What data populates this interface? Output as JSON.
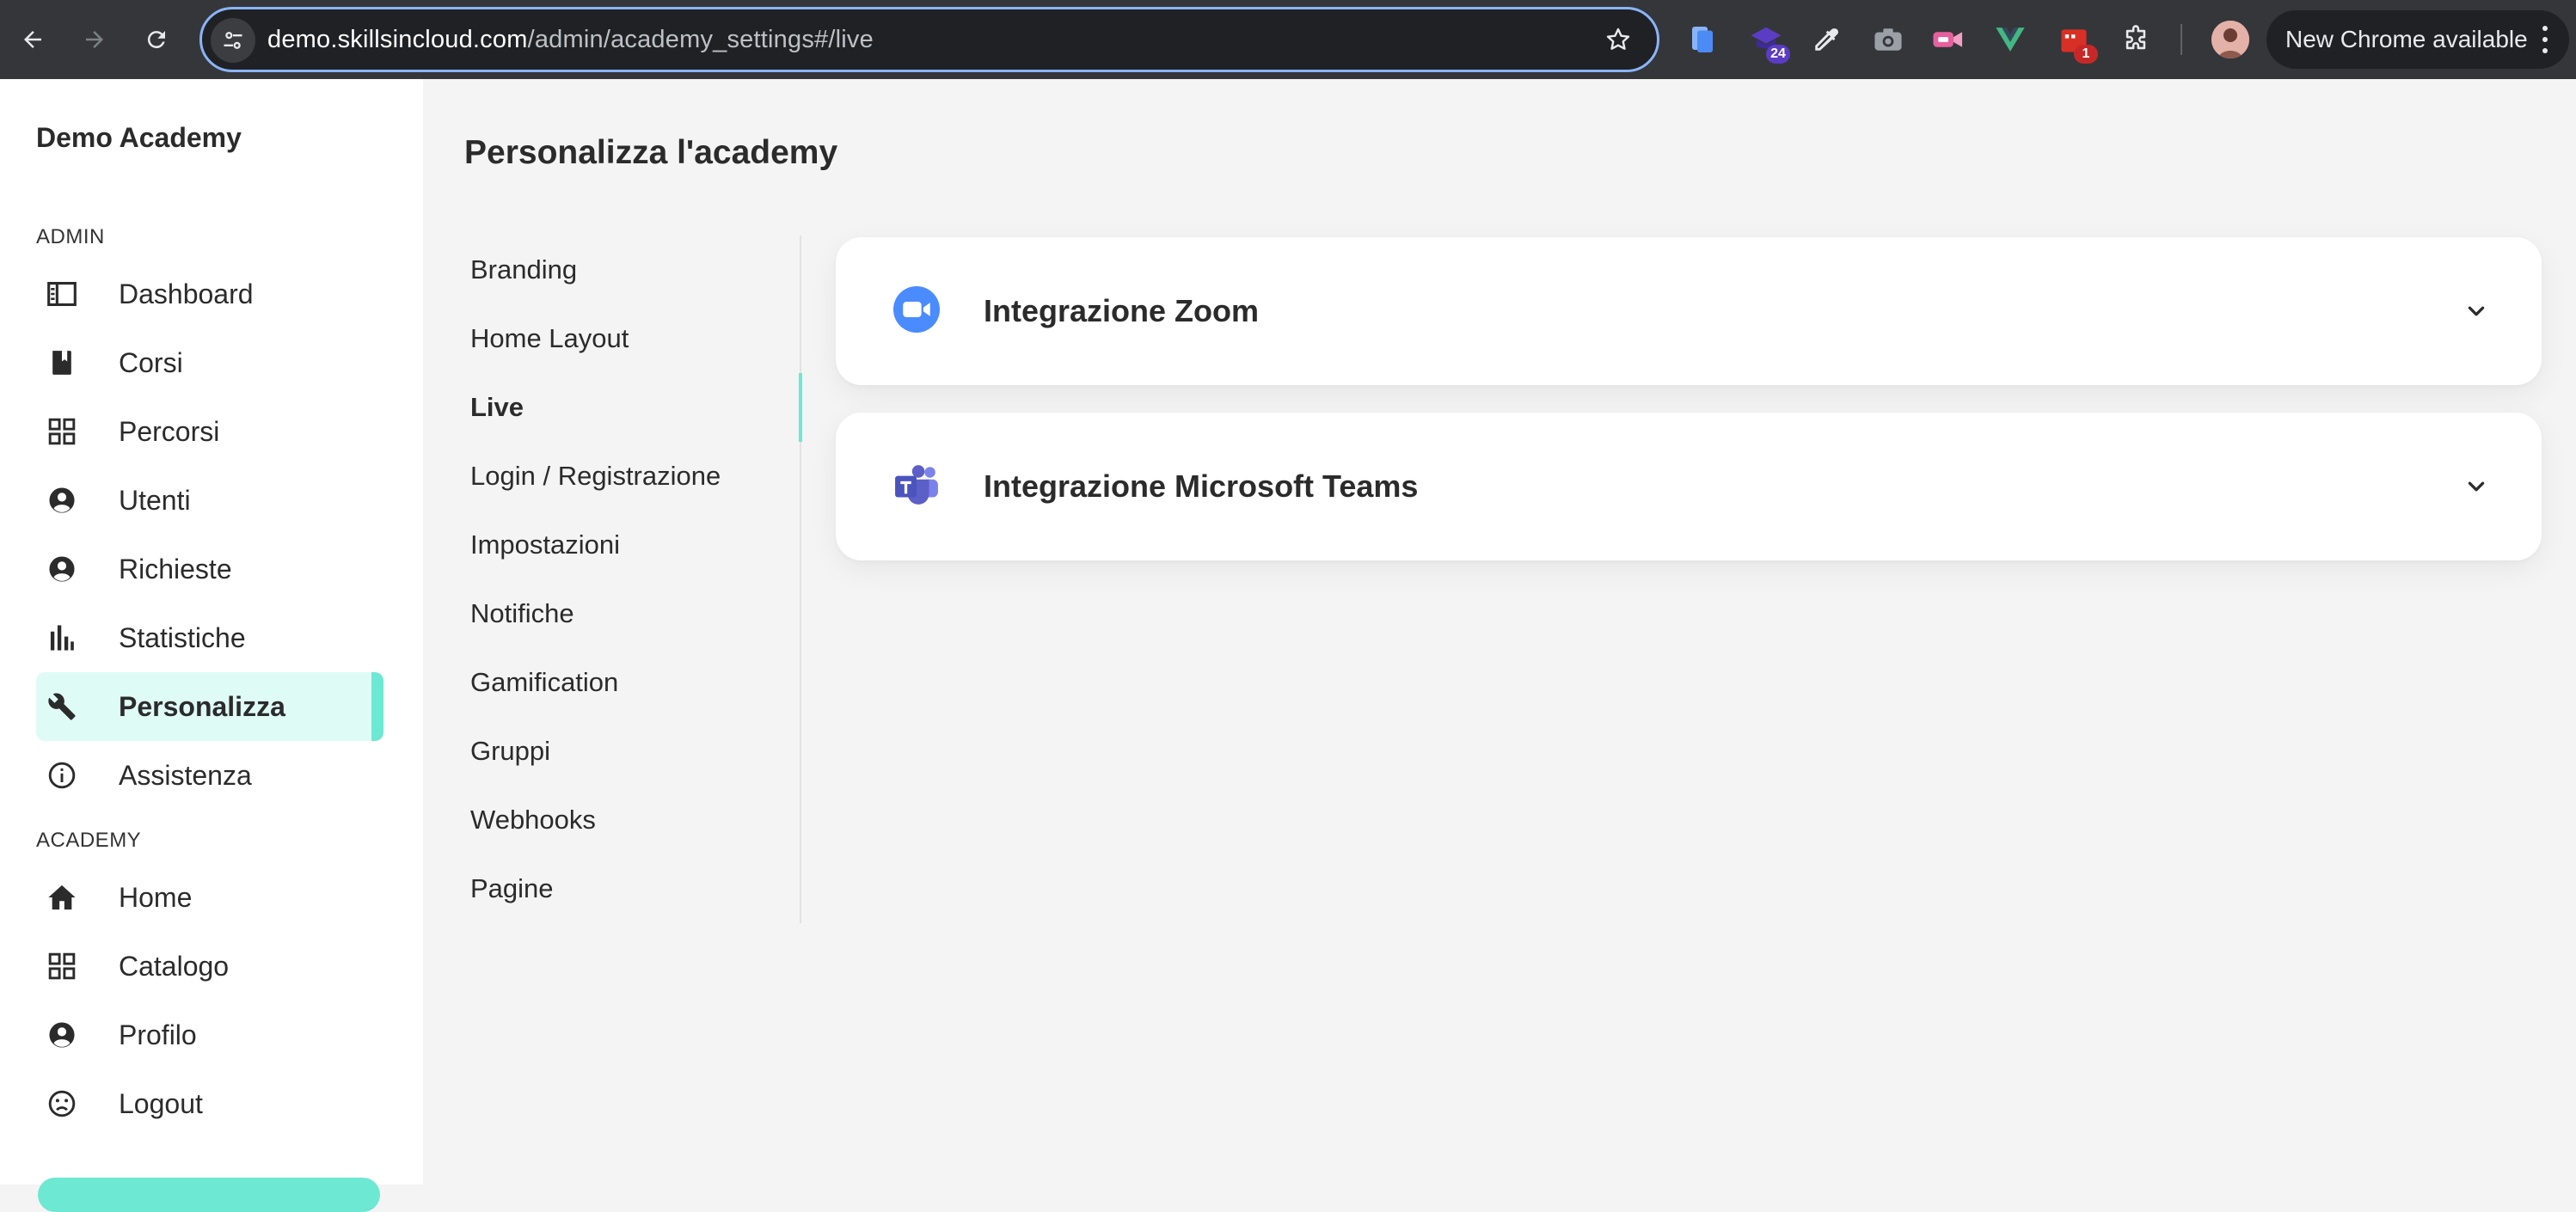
{
  "browser": {
    "url_host": "demo.skillsincloud.com",
    "url_path": "/admin/academy_settings#/live",
    "new_chrome_label": "New Chrome available",
    "extensions": [
      {
        "icon": "document-icon",
        "badge": ""
      },
      {
        "icon": "academy-icon",
        "badge": "24",
        "badge_color": "#5b3cc4"
      },
      {
        "icon": "color-picker-icon",
        "badge": ""
      },
      {
        "icon": "camera-icon",
        "badge": ""
      },
      {
        "icon": "video-record-icon",
        "badge": ""
      },
      {
        "icon": "vue-devtools-icon",
        "badge": ""
      },
      {
        "icon": "calendar-icon",
        "badge": "1",
        "badge_color": "#c62828"
      },
      {
        "icon": "extensions-puzzle-icon",
        "badge": ""
      }
    ]
  },
  "sidebar": {
    "brand": "Demo Academy",
    "admin_section": "ADMIN",
    "academy_section": "ACADEMY",
    "admin_items": [
      {
        "label": "Dashboard",
        "icon": "dashboard-icon"
      },
      {
        "label": "Corsi",
        "icon": "book-icon"
      },
      {
        "label": "Percorsi",
        "icon": "grid-icon"
      },
      {
        "label": "Utenti",
        "icon": "user-icon"
      },
      {
        "label": "Richieste",
        "icon": "user-icon"
      },
      {
        "label": "Statistiche",
        "icon": "bar-chart-icon"
      },
      {
        "label": "Personalizza",
        "icon": "wrench-icon",
        "active": true
      },
      {
        "label": "Assistenza",
        "icon": "info-icon"
      }
    ],
    "academy_items": [
      {
        "label": "Home",
        "icon": "home-icon"
      },
      {
        "label": "Catalogo",
        "icon": "grid-icon"
      },
      {
        "label": "Profilo",
        "icon": "user-icon"
      },
      {
        "label": "Logout",
        "icon": "sad-face-icon"
      }
    ]
  },
  "main": {
    "title": "Personalizza l'academy",
    "sub_nav": [
      {
        "label": "Branding"
      },
      {
        "label": "Home Layout"
      },
      {
        "label": "Live",
        "active": true
      },
      {
        "label": "Login / Registrazione"
      },
      {
        "label": "Impostazioni"
      },
      {
        "label": "Notifiche"
      },
      {
        "label": "Gamification"
      },
      {
        "label": "Gruppi"
      },
      {
        "label": "Webhooks"
      },
      {
        "label": "Pagine"
      }
    ],
    "integrations": [
      {
        "title": "Integrazione Zoom",
        "icon": "zoom-icon",
        "expanded": false
      },
      {
        "title": "Integrazione Microsoft Teams",
        "icon": "teams-icon",
        "expanded": false
      }
    ]
  },
  "colors": {
    "accent": "#6ce8d3",
    "active_bg": "#dffbf6",
    "zoom_blue": "#4a8cff",
    "teams_purple": "#5b5fc7"
  }
}
